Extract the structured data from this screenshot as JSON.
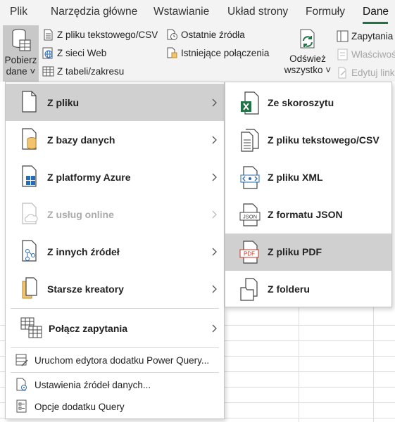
{
  "tabs": [
    {
      "label": "Plik"
    },
    {
      "label": "Narzędzia główne"
    },
    {
      "label": "Wstawianie"
    },
    {
      "label": "Układ strony"
    },
    {
      "label": "Formuły"
    },
    {
      "label": "Dane"
    }
  ],
  "ribbon": {
    "get_data": {
      "line1": "Pobierz",
      "line2": "dane ˅"
    },
    "from_text_csv": "Z pliku tekstowego/CSV",
    "from_web": "Z sieci Web",
    "from_table": "Z tabeli/zakresu",
    "recent_sources": "Ostatnie źródła",
    "existing_connections": "Istniejące połączenia",
    "refresh_all": {
      "line1": "Odśwież",
      "line2": "wszystko ˅"
    },
    "queries": "Zapytania",
    "properties": "Właściwoś",
    "edit_links": "Edytuj link"
  },
  "menu": {
    "items": [
      {
        "label": "Z pliku",
        "icon": "file-icon"
      },
      {
        "label": "Z bazy danych",
        "icon": "database-icon"
      },
      {
        "label": "Z platformy Azure",
        "icon": "azure-icon"
      },
      {
        "label": "Z usług online",
        "icon": "cloud-icon"
      },
      {
        "label": "Z innych źródeł",
        "icon": "other-sources-icon"
      },
      {
        "label": "Starsze kreatory",
        "icon": "legacy-wizard-icon"
      },
      {
        "label": "Połącz zapytania",
        "icon": "combine-queries-icon"
      }
    ],
    "small_items": [
      {
        "label": "Uruchom edytora dodatku Power Query...",
        "icon": "power-query-editor-icon"
      },
      {
        "label": "Ustawienia źródeł danych...",
        "icon": "data-source-settings-icon"
      },
      {
        "label": "Opcje dodatku Query",
        "icon": "query-options-icon"
      }
    ]
  },
  "submenu": {
    "items": [
      {
        "label": "Ze skoroszytu",
        "icon": "excel-workbook-icon"
      },
      {
        "label": "Z pliku tekstowego/CSV",
        "icon": "text-file-icon"
      },
      {
        "label": "Z pliku XML",
        "icon": "xml-file-icon"
      },
      {
        "label": "Z formatu JSON",
        "icon": "json-file-icon"
      },
      {
        "label": "Z pliku PDF",
        "icon": "pdf-file-icon"
      },
      {
        "label": "Z folderu",
        "icon": "folder-icon"
      }
    ]
  },
  "colors": {
    "accent": "#217346",
    "selected": "#d0d0d0",
    "disabled": "#ababab"
  }
}
